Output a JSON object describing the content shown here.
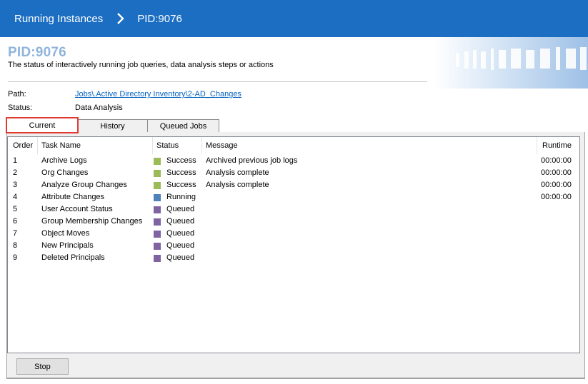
{
  "breadcrumb": {
    "root": "Running Instances",
    "current": "PID:9076",
    "separator_icon": "chevron-right-icon"
  },
  "header": {
    "title": "PID:9076",
    "description": "The status of interactively running job queries, data analysis steps or actions"
  },
  "info": {
    "path_label": "Path:",
    "path_value": "Jobs\\.Active Directory Inventory\\2-AD_Changes",
    "status_label": "Status:",
    "status_value": "Data Analysis"
  },
  "tabs": [
    {
      "label": "Current",
      "active": true
    },
    {
      "label": "History",
      "active": false
    },
    {
      "label": "Queued Jobs",
      "active": false
    }
  ],
  "table": {
    "columns": [
      "Order",
      "Task Name",
      "Status",
      "Message",
      "Runtime"
    ],
    "rows": [
      {
        "order": "1",
        "task": "Archive Logs",
        "status": "Success",
        "message": "Archived previous job logs",
        "runtime": "00:00:00"
      },
      {
        "order": "2",
        "task": "Org Changes",
        "status": "Success",
        "message": "Analysis complete",
        "runtime": "00:00:00"
      },
      {
        "order": "3",
        "task": "Analyze Group Changes",
        "status": "Success",
        "message": "Analysis complete",
        "runtime": "00:00:00"
      },
      {
        "order": "4",
        "task": "Attribute Changes",
        "status": "Running",
        "message": "",
        "runtime": "00:00:00"
      },
      {
        "order": "5",
        "task": "User Account Status",
        "status": "Queued",
        "message": "",
        "runtime": ""
      },
      {
        "order": "6",
        "task": "Group Membership Changes",
        "status": "Queued",
        "message": "",
        "runtime": ""
      },
      {
        "order": "7",
        "task": "Object Moves",
        "status": "Queued",
        "message": "",
        "runtime": ""
      },
      {
        "order": "8",
        "task": "New Principals",
        "status": "Queued",
        "message": "",
        "runtime": ""
      },
      {
        "order": "9",
        "task": "Deleted Principals",
        "status": "Queued",
        "message": "",
        "runtime": ""
      }
    ]
  },
  "status_colors": {
    "Success": "#9bbb59",
    "Running": "#4f81bd",
    "Queued": "#8064a2"
  },
  "buttons": {
    "stop_label": "Stop"
  },
  "colors": {
    "topbar": "#1b6ec2",
    "title_accent": "#8fb4dc",
    "active_tab_highlight": "#e03c31"
  }
}
